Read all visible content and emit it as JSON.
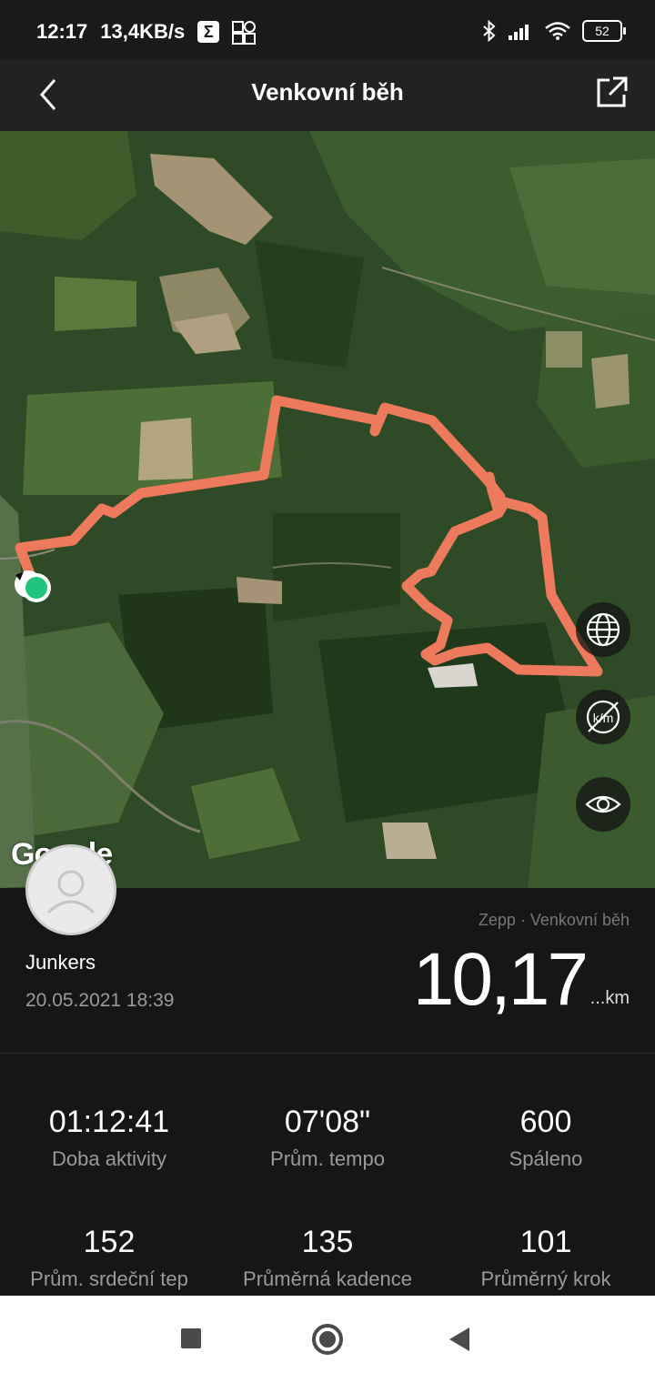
{
  "status_bar": {
    "time": "12:17",
    "network_speed": "13,4KB/s",
    "battery": "52",
    "icons": [
      "sigma-icon",
      "apps-grid-icon",
      "bluetooth-icon",
      "signal-icon",
      "wifi-icon",
      "battery-icon"
    ]
  },
  "header": {
    "title": "Venkovní běh",
    "back_icon": "back-arrow-icon",
    "share_icon": "share-icon"
  },
  "map": {
    "attribution": "Google",
    "route_color": "#ee7a5d",
    "controls": [
      "globe-icon",
      "km-marker-off-icon",
      "eye-icon"
    ]
  },
  "workout": {
    "user_name": "Junkers",
    "datetime": "20.05.2021 18:39",
    "source": "Zepp · Venkovní běh",
    "distance": "10,17",
    "distance_unit": "...km"
  },
  "stats": [
    {
      "value": "01:12:41",
      "label": "Doba aktivity"
    },
    {
      "value": "07'08\"",
      "label": "Prům. tempo"
    },
    {
      "value": "600",
      "label": "Spáleno"
    },
    {
      "value": "152",
      "label": "Prům. srdeční tep"
    },
    {
      "value": "135",
      "label": "Průměrná kadence"
    },
    {
      "value": "101",
      "label": "Průměrný krok"
    }
  ],
  "nav_bar": [
    "recents-square-icon",
    "home-circle-icon",
    "back-triangle-icon"
  ]
}
